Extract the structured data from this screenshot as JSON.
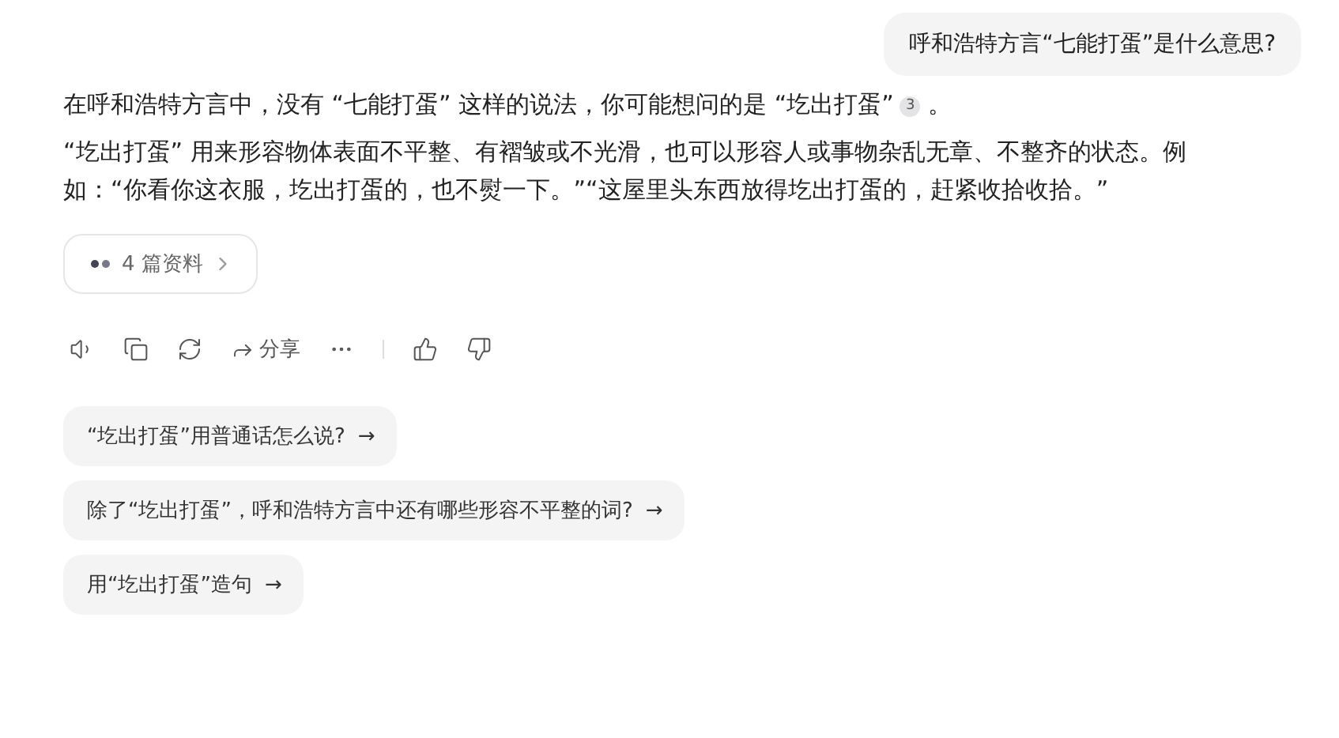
{
  "user_message": "呼和浩特方言“七能打蛋”是什么意思?",
  "answer": {
    "paragraphs": [
      {
        "text": "在呼和浩特方言中，没有 “七能打蛋” 这样的说法，你可能想问的是 “圪出打蛋”",
        "citation": "3",
        "end": " 。"
      },
      {
        "text": "“圪出打蛋” 用来形容物体表面不平整、有褶皱或不光滑，也可以形容人或事物杂乱无章、不整齐的状态。例如：“你看你这衣服，圪出打蛋的，也不熨一下。”“这屋里头东西放得圪出打蛋的，赶紧收拾收拾。”"
      }
    ],
    "sources": {
      "label": "4 篇资料"
    }
  },
  "actions": [
    {
      "kind": "speak"
    },
    {
      "kind": "copy"
    },
    {
      "kind": "regenerate"
    },
    {
      "kind": "share",
      "label": "分享"
    },
    {
      "kind": "more"
    },
    {
      "kind": "divider"
    },
    {
      "kind": "like"
    },
    {
      "kind": "dislike"
    }
  ],
  "suggestions": [
    {
      "text": "“圪出打蛋”用普通话怎么说?",
      "arrow": "→"
    },
    {
      "text": "除了“圪出打蛋”，呼和浩特方言中还有哪些形容不平整的词?",
      "arrow": "→"
    },
    {
      "text": "用“圪出打蛋”造句",
      "arrow": "→"
    }
  ]
}
